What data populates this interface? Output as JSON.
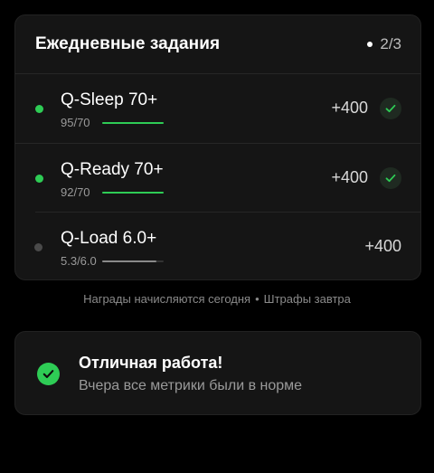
{
  "tasks_card": {
    "title": "Ежедневные задания",
    "progress": "2/3",
    "tasks": [
      {
        "name": "Q-Sleep 70+",
        "value": "95/70",
        "reward": "+400",
        "completed": true,
        "bar_fraction": 1.0,
        "color": "#2ecc55"
      },
      {
        "name": "Q-Ready 70+",
        "value": "92/70",
        "reward": "+400",
        "completed": true,
        "bar_fraction": 1.0,
        "color": "#2ecc55"
      },
      {
        "name": "Q-Load 6.0+",
        "value": "5.3/6.0",
        "reward": "+400",
        "completed": false,
        "bar_fraction": 0.88,
        "color": "#8a8a8a"
      }
    ]
  },
  "footnote": {
    "left": "Награды начисляются сегодня",
    "separator": "•",
    "right": "Штрафы завтра"
  },
  "success_card": {
    "title": "Отличная работа!",
    "subtitle": "Вчера все метрики были в норме",
    "icon": "check-circle-icon",
    "accent": "#2ecc55"
  }
}
